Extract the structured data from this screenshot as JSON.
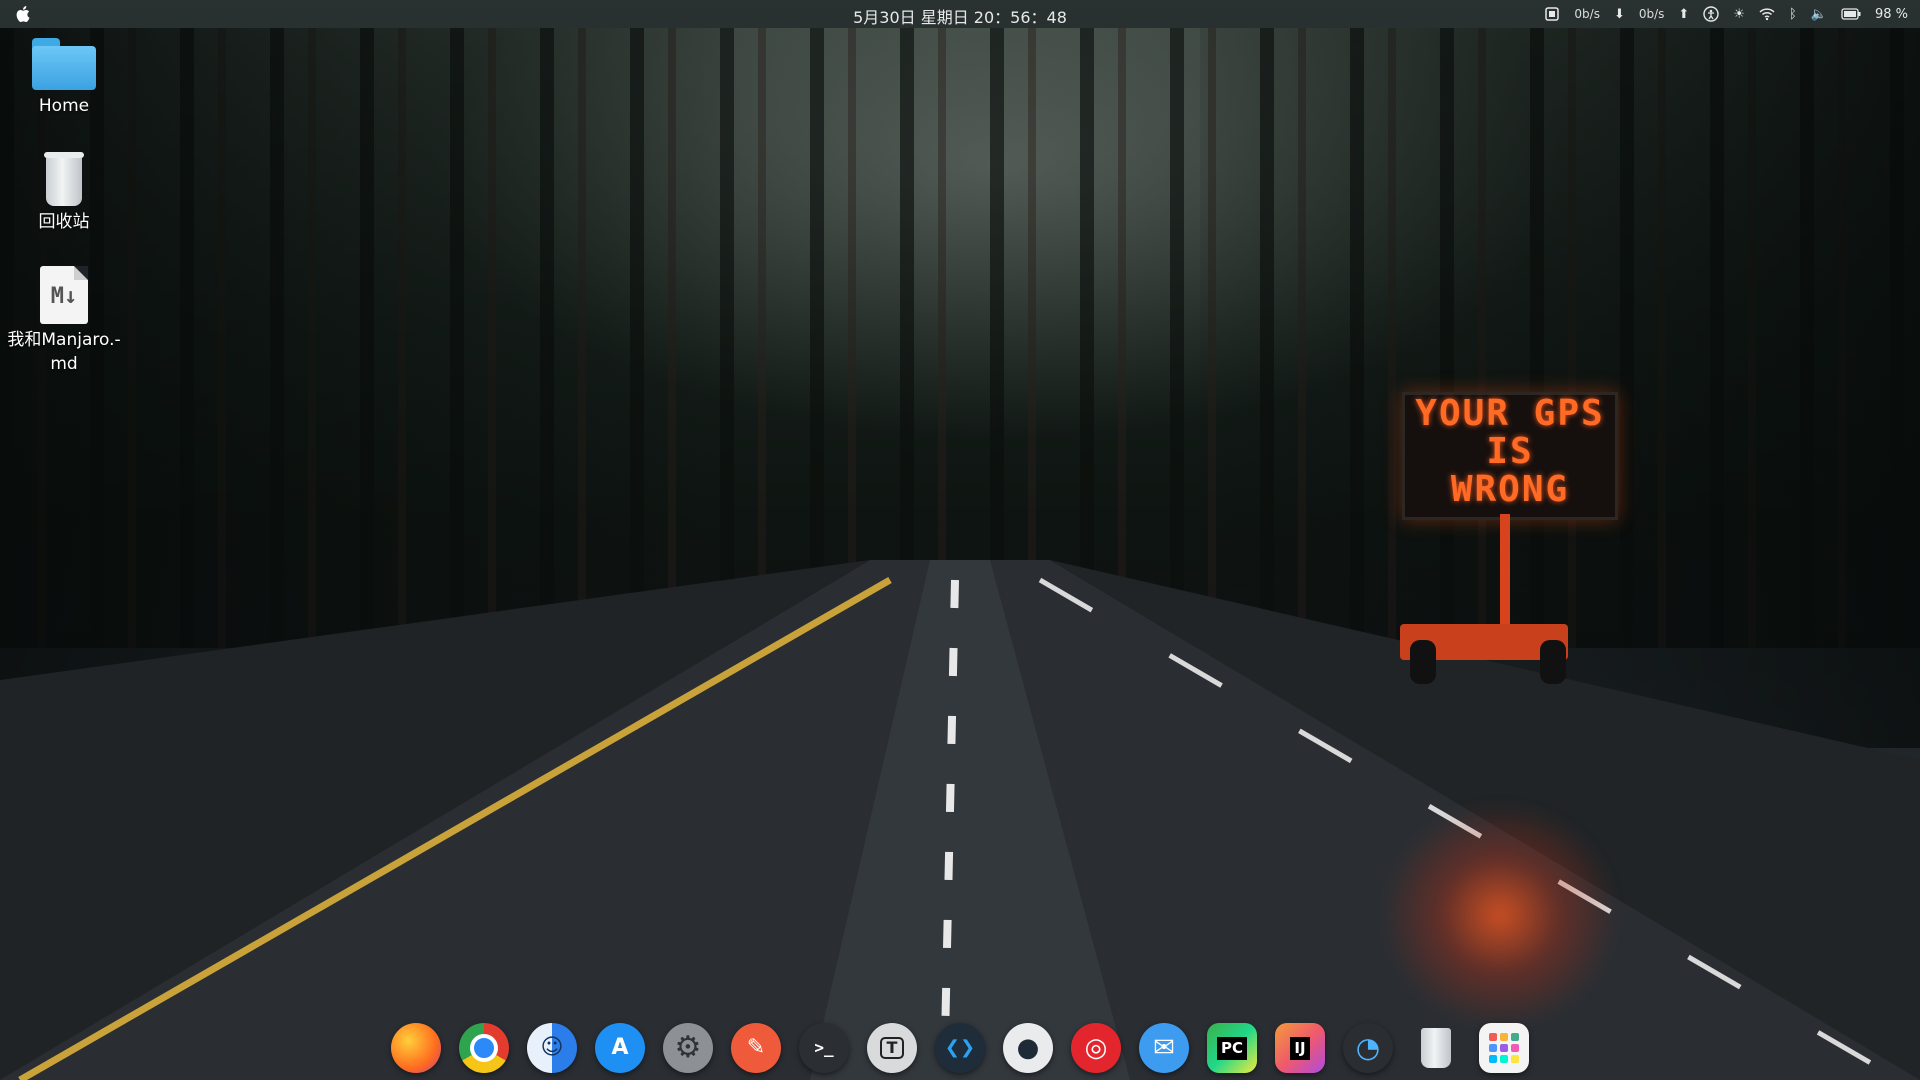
{
  "topbar": {
    "datetime": "5月30日 星期日 20：56：48",
    "net_down": "0b/s",
    "net_up": "0b/s",
    "battery": "98 %"
  },
  "desktop_icons": [
    {
      "label": "Home",
      "icon": "folder-home-icon"
    },
    {
      "label": "回收站",
      "icon": "trash-icon"
    },
    {
      "label": "我和Manjaro.-md",
      "icon": "markdown-file-icon"
    }
  ],
  "wallpaper": {
    "sign_line1": "YOUR GPS",
    "sign_line2": "IS",
    "sign_line3": "WRONG"
  },
  "dock": [
    {
      "name": "firefox",
      "glyph": "",
      "bg": "#ff6d1f"
    },
    {
      "name": "chrome",
      "glyph": "",
      "bg": "#2b8af7"
    },
    {
      "name": "finder",
      "glyph": "☺",
      "bg": "#2b7de9"
    },
    {
      "name": "app-store",
      "glyph": "A",
      "bg": "#1e90f3"
    },
    {
      "name": "system-preferences",
      "glyph": "⚙",
      "bg": "#8d9196"
    },
    {
      "name": "text-editor",
      "glyph": "✎",
      "bg": "#ef5a3a"
    },
    {
      "name": "terminal",
      "glyph": ">_",
      "bg": "#2b2f33"
    },
    {
      "name": "typora",
      "glyph": "T",
      "bg": "#d9dadb"
    },
    {
      "name": "vscode",
      "glyph": "❮❯",
      "bg": "#1f2d3a"
    },
    {
      "name": "camera",
      "glyph": "●",
      "bg": "#e9ebec"
    },
    {
      "name": "netease-music",
      "glyph": "◎",
      "bg": "#e3262e"
    },
    {
      "name": "mail",
      "glyph": "✉",
      "bg": "#3d9bf0"
    },
    {
      "name": "pycharm",
      "glyph": "PC",
      "bg": "#3ab14a"
    },
    {
      "name": "intellij",
      "glyph": "IJ",
      "bg": "#f29b3a"
    },
    {
      "name": "system-monitor",
      "glyph": "◔",
      "bg": "#2a2e33"
    },
    {
      "name": "trash-dock",
      "glyph": "",
      "bg": "#d7dbde"
    },
    {
      "name": "launchpad",
      "glyph": "▦",
      "bg": "#f4f4f4"
    }
  ]
}
